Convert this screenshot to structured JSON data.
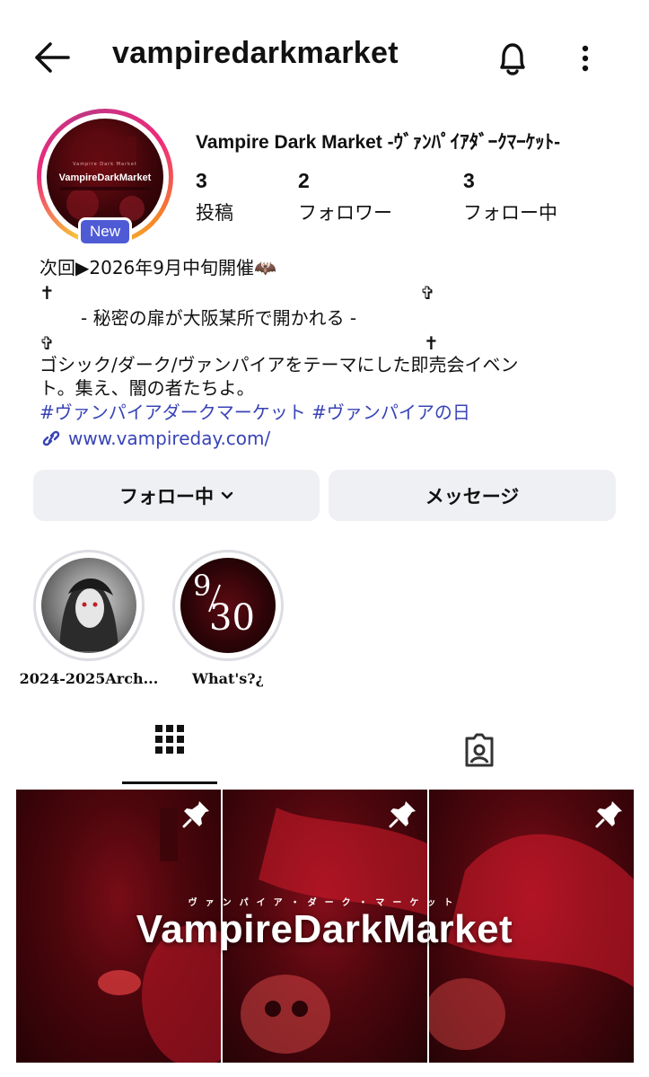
{
  "header": {
    "username": "vampiredarkmarket",
    "icons": [
      "back-arrow-icon",
      "bell-icon",
      "more-vertical-icon"
    ]
  },
  "profile": {
    "display_name": "Vampire Dark Market -ｳﾞｧﾝﾊﾟｲｱﾀﾞｰｸﾏｰｹｯﾄ-",
    "new_badge": "New",
    "avatar_title": "VampireDarkMarket",
    "avatar_subtitle": "Vampire Dark Market",
    "stats": [
      {
        "value": "3",
        "label": "投稿"
      },
      {
        "value": "2",
        "label": "フォロワー"
      },
      {
        "value": "3",
        "label": "フォロー中"
      }
    ]
  },
  "bio": {
    "line1": "次回▶2026年9月中旬開催🦇",
    "cross1": "✝",
    "cross2": "✞",
    "line2": "- 秘密の扉が大阪某所で開かれる -",
    "cross3": "✞",
    "cross4": "✝",
    "line3": "ゴシック/ダーク/ヴァンパイアをテーマにした即売会イベン",
    "line4": "ト。集え、闇の者たちよ。",
    "hashtags": "#ヴァンパイアダークマーケット #ヴァンパイアの日",
    "link": "www.vampireday.com/"
  },
  "buttons": {
    "following": "フォロー中",
    "message": "メッセージ"
  },
  "highlights": [
    {
      "label": "2024-2025Arch..."
    },
    {
      "label": "What's?¿",
      "overlay_top": "9",
      "overlay_bottom": "30"
    }
  ],
  "grid": {
    "banner_small": "ヴァンパイア・ダーク・マーケット",
    "banner_big": "VampireDarkMarket",
    "tiles": 3
  },
  "colors": {
    "link": "#3843b6",
    "badge": "#4f5bd5",
    "button_bg": "#eff0f3"
  }
}
